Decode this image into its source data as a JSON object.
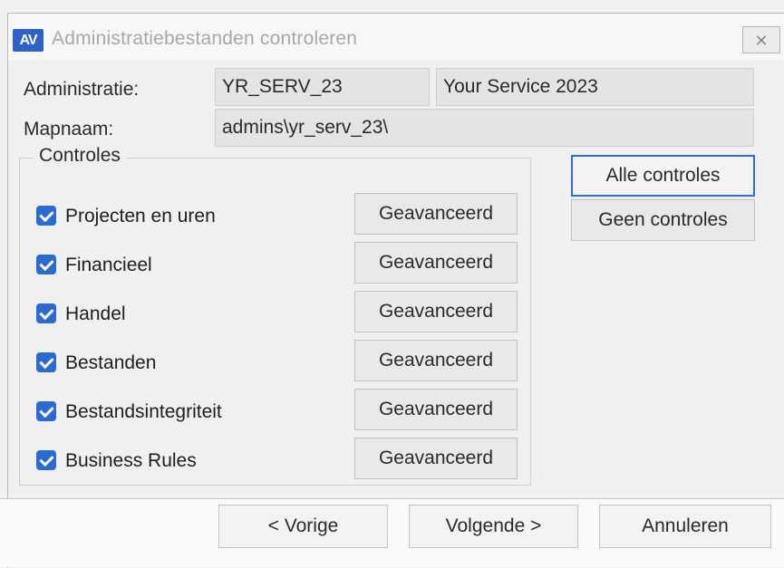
{
  "window": {
    "title": "Administratiebestanden controleren",
    "icon_text": "AV",
    "close_glyph": "✕"
  },
  "fields": {
    "administratie_label": "Administratie:",
    "administratie_code": "YR_SERV_23",
    "administratie_name": "Your Service 2023",
    "mapnaam_label": "Mapnaam:",
    "mapnaam_value": "admins\\yr_serv_23\\"
  },
  "controles": {
    "legend": "Controles",
    "items": [
      {
        "label": "Projecten en uren",
        "checked": true,
        "button": "Geavanceerd"
      },
      {
        "label": "Financieel",
        "checked": true,
        "button": "Geavanceerd"
      },
      {
        "label": "Handel",
        "checked": true,
        "button": "Geavanceerd"
      },
      {
        "label": "Bestanden",
        "checked": true,
        "button": "Geavanceerd"
      },
      {
        "label": "Bestandsintegriteit",
        "checked": true,
        "button": "Geavanceerd"
      },
      {
        "label": "Business Rules",
        "checked": true,
        "button": "Geavanceerd"
      }
    ]
  },
  "actions": {
    "all_label": "Alle controles",
    "none_label": "Geen controles"
  },
  "footer": {
    "prev_label": "< Vorige",
    "next_label": "Volgende >",
    "cancel_label": "Annuleren"
  },
  "colors": {
    "accent": "#2a6fd6",
    "checkbox": "#2b6bd1"
  },
  "icons": {
    "app": "av-logo-icon",
    "close": "close-icon",
    "check": "checkmark-icon"
  }
}
